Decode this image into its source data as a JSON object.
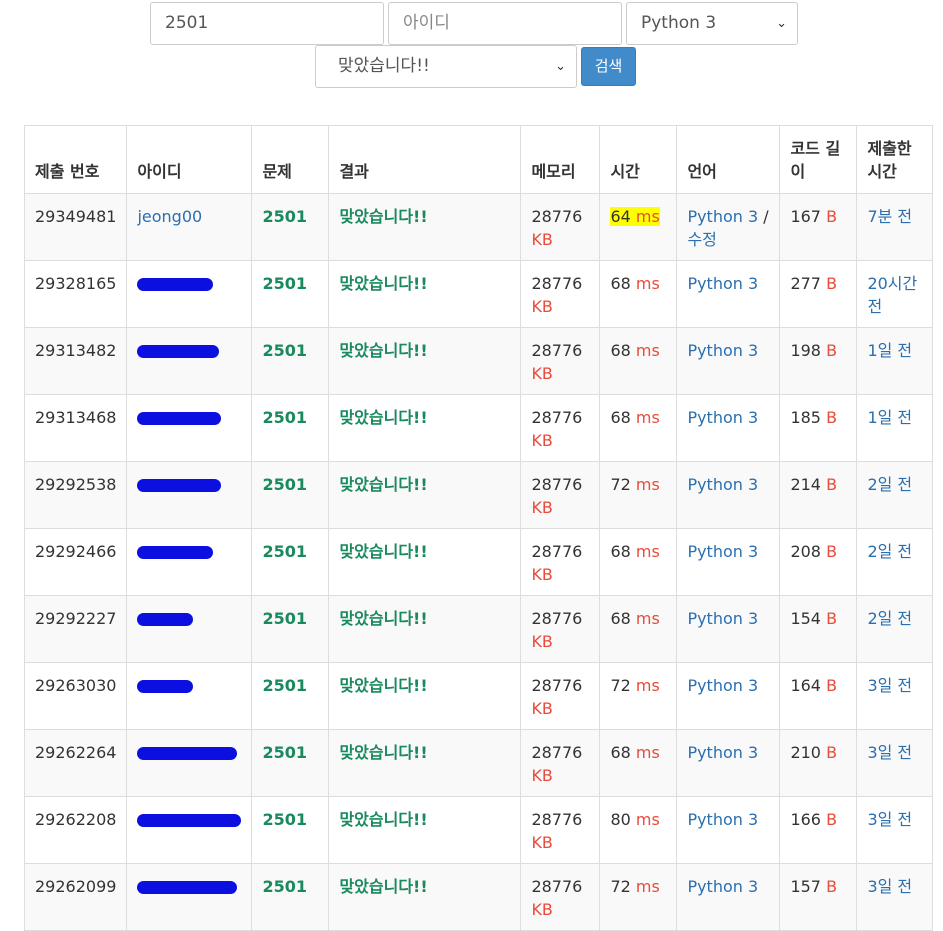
{
  "search": {
    "problem_value": "2501",
    "user_placeholder": "아이디",
    "language_selected": "Python 3",
    "result_selected": "맞았습니다!!",
    "search_label": "검색"
  },
  "table": {
    "headers": [
      "제출 번호",
      "아이디",
      "문제",
      "결과",
      "메모리",
      "시간",
      "언어",
      "코드 길이",
      "제출한 시간"
    ],
    "unit_kb": "KB",
    "unit_ms": "ms",
    "unit_b": "B",
    "rows": [
      {
        "id": "29349481",
        "user": "jeong00",
        "problem": "2501",
        "result": "맞았습니다!!",
        "memory": "28776",
        "time": "64",
        "lang": "Python 3",
        "lang_extra": "수정",
        "code": "167",
        "submitted": "7분 전"
      },
      {
        "id": "29328165",
        "user": "",
        "problem": "2501",
        "result": "맞았습니다!!",
        "memory": "28776",
        "time": "68",
        "lang": "Python 3",
        "code": "277",
        "submitted": "20시간 전"
      },
      {
        "id": "29313482",
        "user": "",
        "problem": "2501",
        "result": "맞았습니다!!",
        "memory": "28776",
        "time": "68",
        "lang": "Python 3",
        "code": "198",
        "submitted": "1일 전"
      },
      {
        "id": "29313468",
        "user": "",
        "problem": "2501",
        "result": "맞았습니다!!",
        "memory": "28776",
        "time": "68",
        "lang": "Python 3",
        "code": "185",
        "submitted": "1일 전"
      },
      {
        "id": "29292538",
        "user": "",
        "problem": "2501",
        "result": "맞았습니다!!",
        "memory": "28776",
        "time": "72",
        "lang": "Python 3",
        "code": "214",
        "submitted": "2일 전"
      },
      {
        "id": "29292466",
        "user": "",
        "problem": "2501",
        "result": "맞았습니다!!",
        "memory": "28776",
        "time": "68",
        "lang": "Python 3",
        "code": "208",
        "submitted": "2일 전"
      },
      {
        "id": "29292227",
        "user": "",
        "problem": "2501",
        "result": "맞았습니다!!",
        "memory": "28776",
        "time": "68",
        "lang": "Python 3",
        "code": "154",
        "submitted": "2일 전"
      },
      {
        "id": "29263030",
        "user": "",
        "problem": "2501",
        "result": "맞았습니다!!",
        "memory": "28776",
        "time": "72",
        "lang": "Python 3",
        "code": "164",
        "submitted": "3일 전"
      },
      {
        "id": "29262264",
        "user": "",
        "problem": "2501",
        "result": "맞았습니다!!",
        "memory": "28776",
        "time": "68",
        "lang": "Python 3",
        "code": "210",
        "submitted": "3일 전"
      },
      {
        "id": "29262208",
        "user": "",
        "problem": "2501",
        "result": "맞았습니다!!",
        "memory": "28776",
        "time": "80",
        "lang": "Python 3",
        "code": "166",
        "submitted": "3일 전"
      },
      {
        "id": "29262099",
        "user": "",
        "problem": "2501",
        "result": "맞았습니다!!",
        "memory": "28776",
        "time": "72",
        "lang": "Python 3",
        "code": "157",
        "submitted": "3일 전"
      }
    ]
  },
  "colors": {
    "link": "#2a6fb0",
    "correct": "#1a8a5e",
    "unit": "#e74c3c",
    "highlight": "#ffff00",
    "redaction": "#0b10e0",
    "button": "#428bca"
  }
}
